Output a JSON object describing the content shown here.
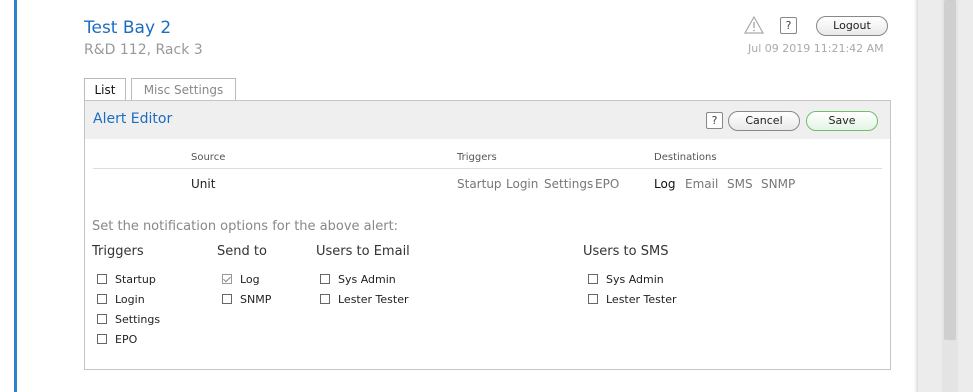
{
  "header": {
    "title": "Test Bay 2",
    "subtitle": "R&D 112, Rack 3",
    "help_label": "?",
    "logout_label": "Logout",
    "timestamp": "Jul 09 2019 11:21:42 AM"
  },
  "tabs": [
    {
      "label": "List",
      "active": true
    },
    {
      "label": "Misc Settings",
      "active": false
    }
  ],
  "editor": {
    "title": "Alert Editor",
    "help_label": "?",
    "cancel_label": "Cancel",
    "save_label": "Save",
    "columns": {
      "source": "Source",
      "triggers": "Triggers",
      "destinations": "Destinations"
    },
    "row": {
      "source": "Unit",
      "triggers": [
        "Startup",
        "Login",
        "Settings",
        "EPO"
      ],
      "destinations": [
        {
          "label": "Log",
          "active": true
        },
        {
          "label": "Email",
          "active": false
        },
        {
          "label": "SMS",
          "active": false
        },
        {
          "label": "SNMP",
          "active": false
        }
      ]
    },
    "instructions": "Set the notification options for the above alert:",
    "sections": {
      "triggers": {
        "heading": "Triggers",
        "options": [
          {
            "label": "Startup",
            "checked": false
          },
          {
            "label": "Login",
            "checked": false
          },
          {
            "label": "Settings",
            "checked": false
          },
          {
            "label": "EPO",
            "checked": false
          }
        ]
      },
      "send_to": {
        "heading": "Send to",
        "options": [
          {
            "label": "Log",
            "checked": true
          },
          {
            "label": "SNMP",
            "checked": false
          }
        ]
      },
      "users_email": {
        "heading": "Users to Email",
        "options": [
          {
            "label": "Sys Admin",
            "checked": false
          },
          {
            "label": "Lester Tester",
            "checked": false
          }
        ]
      },
      "users_sms": {
        "heading": "Users to SMS",
        "options": [
          {
            "label": "Sys Admin",
            "checked": false
          },
          {
            "label": "Lester Tester",
            "checked": false
          }
        ]
      }
    }
  },
  "colors": {
    "accent": "#1c6cc0",
    "frame": "#2f7fd1",
    "save_border": "#6fbe6f"
  }
}
